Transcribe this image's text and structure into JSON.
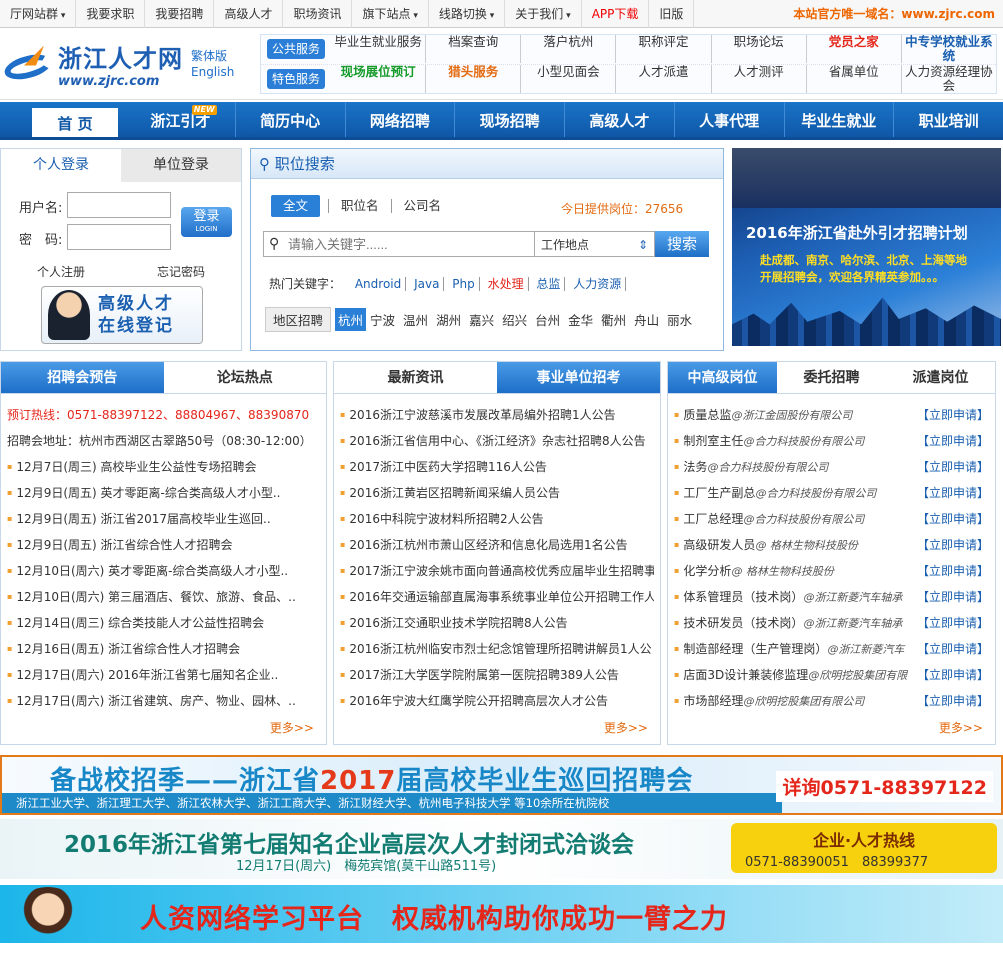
{
  "topbar": {
    "items": [
      "厅网站群",
      "我要求职",
      "我要招聘",
      "高级人才",
      "职场资讯",
      "旗下站点",
      "线路切换",
      "关于我们",
      "APP下载",
      "旧版"
    ],
    "domain_notice": "本站官方唯一域名：www.zjrc.com"
  },
  "logo": {
    "cn": "浙江人才网",
    "en": "www.zjrc.com",
    "lang1": "繁体版",
    "lang2": "English"
  },
  "services": {
    "public_label": "公共服务",
    "public_items": [
      "毕业生就业服务",
      "档案查询",
      "落户杭州",
      "职称评定",
      "职场论坛",
      "党员之家",
      "中专学校就业系统"
    ],
    "special_label": "特色服务",
    "special_items": [
      "现场展位预订",
      "猎头服务",
      "小型见面会",
      "人才派遣",
      "人才测评",
      "省属单位",
      "人力资源经理协会"
    ]
  },
  "nav": {
    "items": [
      "首 页",
      "浙江引才",
      "简历中心",
      "网络招聘",
      "现场招聘",
      "高级人才",
      "人事代理",
      "毕业生就业",
      "职业培训"
    ],
    "new_badge": "NEW"
  },
  "login": {
    "tab_personal": "个人登录",
    "tab_company": "单位登录",
    "user_label": "用户名:",
    "pass_label": "密　码:",
    "login_btn": "登录",
    "login_btn_en": "LOGIN",
    "register": "个人注册",
    "forgot": "忘记密码",
    "promo1": "高级人才",
    "promo2": "在线登记"
  },
  "search": {
    "title": "职位搜索",
    "modes": [
      "全文",
      "职位名",
      "公司名"
    ],
    "today_count": "今日提供岗位：27656",
    "placeholder": "请输入关键字......",
    "location": "工作地点",
    "button": "搜索",
    "hot_label": "热门关键字：",
    "hot": [
      "Android",
      "Java",
      "Php",
      "水处理",
      "总监",
      "人力资源"
    ],
    "area_label": "地区招聘",
    "areas": [
      "杭州",
      "宁波",
      "温州",
      "湖州",
      "嘉兴",
      "绍兴",
      "台州",
      "金华",
      "衢州",
      "舟山",
      "丽水"
    ]
  },
  "banner1": {
    "title": "2016年浙江省赴外引才招聘计划",
    "line1": "赴成都、南京、哈尔滨、北京、上海等地",
    "line2": "开展招聘会，欢迎各界精英参加。。。"
  },
  "col1": {
    "tabs": [
      "招聘会预告",
      "论坛热点"
    ],
    "hotline": "预订热线：0571-88397122、88804967、88390870",
    "address": "招聘会地址：杭州市西湖区古翠路50号（08:30-12:00）",
    "items": [
      "12月7日(周三) 高校毕业生公益性专场招聘会",
      "12月9日(周五) 英才零距离-综合类高级人才小型..",
      "12月9日(周五) 浙江省2017届高校毕业生巡回..",
      "12月9日(周五) 浙江省综合性人才招聘会",
      "12月10日(周六) 英才零距离-综合类高级人才小型..",
      "12月10日(周六) 第三届酒店、餐饮、旅游、食品、..",
      "12月14日(周三) 综合类技能人才公益性招聘会",
      "12月16日(周五) 浙江省综合性人才招聘会",
      "12月17日(周六) 2016年浙江省第七届知名企业..",
      "12月17日(周六) 浙江省建筑、房产、物业、园林、.."
    ],
    "more": "更多>>"
  },
  "col2": {
    "tabs": [
      "最新资讯",
      "事业单位招考"
    ],
    "items": [
      "2016浙江宁波慈溪市发展改革局编外招聘1人公告",
      "2016浙江省信用中心、《浙江经济》杂志社招聘8人公告",
      "2017浙江中医药大学招聘116人公告",
      "2016浙江黄岩区招聘新闻采编人员公告",
      "2016中科院宁波材料所招聘2人公告",
      "2016浙江杭州市萧山区经济和信息化局选用1名公告",
      "2017浙江宁波余姚市面向普通高校优秀应届毕业生招聘事",
      "2016年交通运输部直属海事系统事业单位公开招聘工作人",
      "2016浙江交通职业技术学院招聘8人公告",
      "2016浙江杭州临安市烈士纪念馆管理所招聘讲解员1人公",
      "2017浙江大学医学院附属第一医院招聘389人公告",
      "2016年宁波大红鹰学院公开招聘高层次人才公告"
    ],
    "more": "更多>>"
  },
  "col3": {
    "tabs": [
      "中高级岗位",
      "委托招聘",
      "派遣岗位"
    ],
    "apply": "【立即申请】",
    "items": [
      {
        "job": "质量总监",
        "co": "@浙江金固股份有限公司"
      },
      {
        "job": "制剂室主任",
        "co": "@合力科技股份有限公司"
      },
      {
        "job": "法务",
        "co": "@合力科技股份有限公司"
      },
      {
        "job": "工厂生产副总",
        "co": "@合力科技股份有限公司"
      },
      {
        "job": "工厂总经理",
        "co": "@合力科技股份有限公司"
      },
      {
        "job": "高级研发人员",
        "co": "@ 格林生物科技股份"
      },
      {
        "job": "化学分析",
        "co": "@ 格林生物科技股份"
      },
      {
        "job": "体系管理员（技术岗）",
        "co": "@浙江新菱汽车轴承"
      },
      {
        "job": "技术研发员（技术岗）",
        "co": "@浙江新菱汽车轴承"
      },
      {
        "job": "制造部经理（生产管理岗）",
        "co": "@浙江新菱汽车"
      },
      {
        "job": "店面3D设计兼装修监理",
        "co": "@欣明挖股集团有限"
      },
      {
        "job": "市场部经理",
        "co": "@欣明挖股集团有限公司"
      }
    ],
    "more": "更多>>"
  },
  "banner2": {
    "title_a": "备战校招季——浙江省",
    "title_year": "2017",
    "title_b": "届高校毕业生巡回招聘会",
    "schools": "浙江工业大学、浙江理工大学、浙江农林大学、浙江工商大学、浙江财经大学、杭州电子科技大学 等10余所在杭院校",
    "phone": "详询0571-88397122"
  },
  "banner3": {
    "title": "2016年浙江省第七届知名企业高层次人才封闭式洽谈会",
    "sub": "12月17日(周六)　梅苑宾馆(莫干山路511号)",
    "hot_title": "企业·人才热线",
    "hot_phones": "0571-88390051　88399377"
  },
  "banner4": {
    "title": "人资网络学习平台　权威机构助你成功一臂之力"
  }
}
